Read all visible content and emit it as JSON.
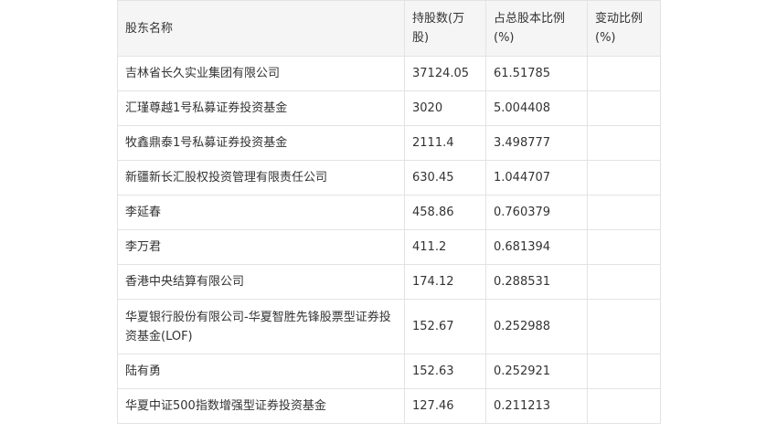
{
  "table": {
    "headers": [
      "股东名称",
      "持股数(万股)",
      "占总股本比例(%)",
      "变动比例(%)"
    ],
    "rows": [
      {
        "name": "吉林省长久实业集团有限公司",
        "shares": "37124.05",
        "ratio": "61.51785",
        "change": ""
      },
      {
        "name": "汇瑾尊越1号私募证券投资基金",
        "shares": "3020",
        "ratio": "5.004408",
        "change": ""
      },
      {
        "name": "牧鑫鼎泰1号私募证券投资基金",
        "shares": "2111.4",
        "ratio": "3.498777",
        "change": ""
      },
      {
        "name": "新疆新长汇股权投资管理有限责任公司",
        "shares": "630.45",
        "ratio": "1.044707",
        "change": ""
      },
      {
        "name": "李延春",
        "shares": "458.86",
        "ratio": "0.760379",
        "change": ""
      },
      {
        "name": "李万君",
        "shares": "411.2",
        "ratio": "0.681394",
        "change": ""
      },
      {
        "name": "香港中央结算有限公司",
        "shares": "174.12",
        "ratio": "0.288531",
        "change": ""
      },
      {
        "name": "华夏银行股份有限公司-华夏智胜先锋股票型证券投资基金(LOF)",
        "shares": "152.67",
        "ratio": "0.252988",
        "change": ""
      },
      {
        "name": "陆有勇",
        "shares": "152.63",
        "ratio": "0.252921",
        "change": ""
      },
      {
        "name": "华夏中证500指数增强型证券投资基金",
        "shares": "127.46",
        "ratio": "0.211213",
        "change": ""
      }
    ]
  }
}
